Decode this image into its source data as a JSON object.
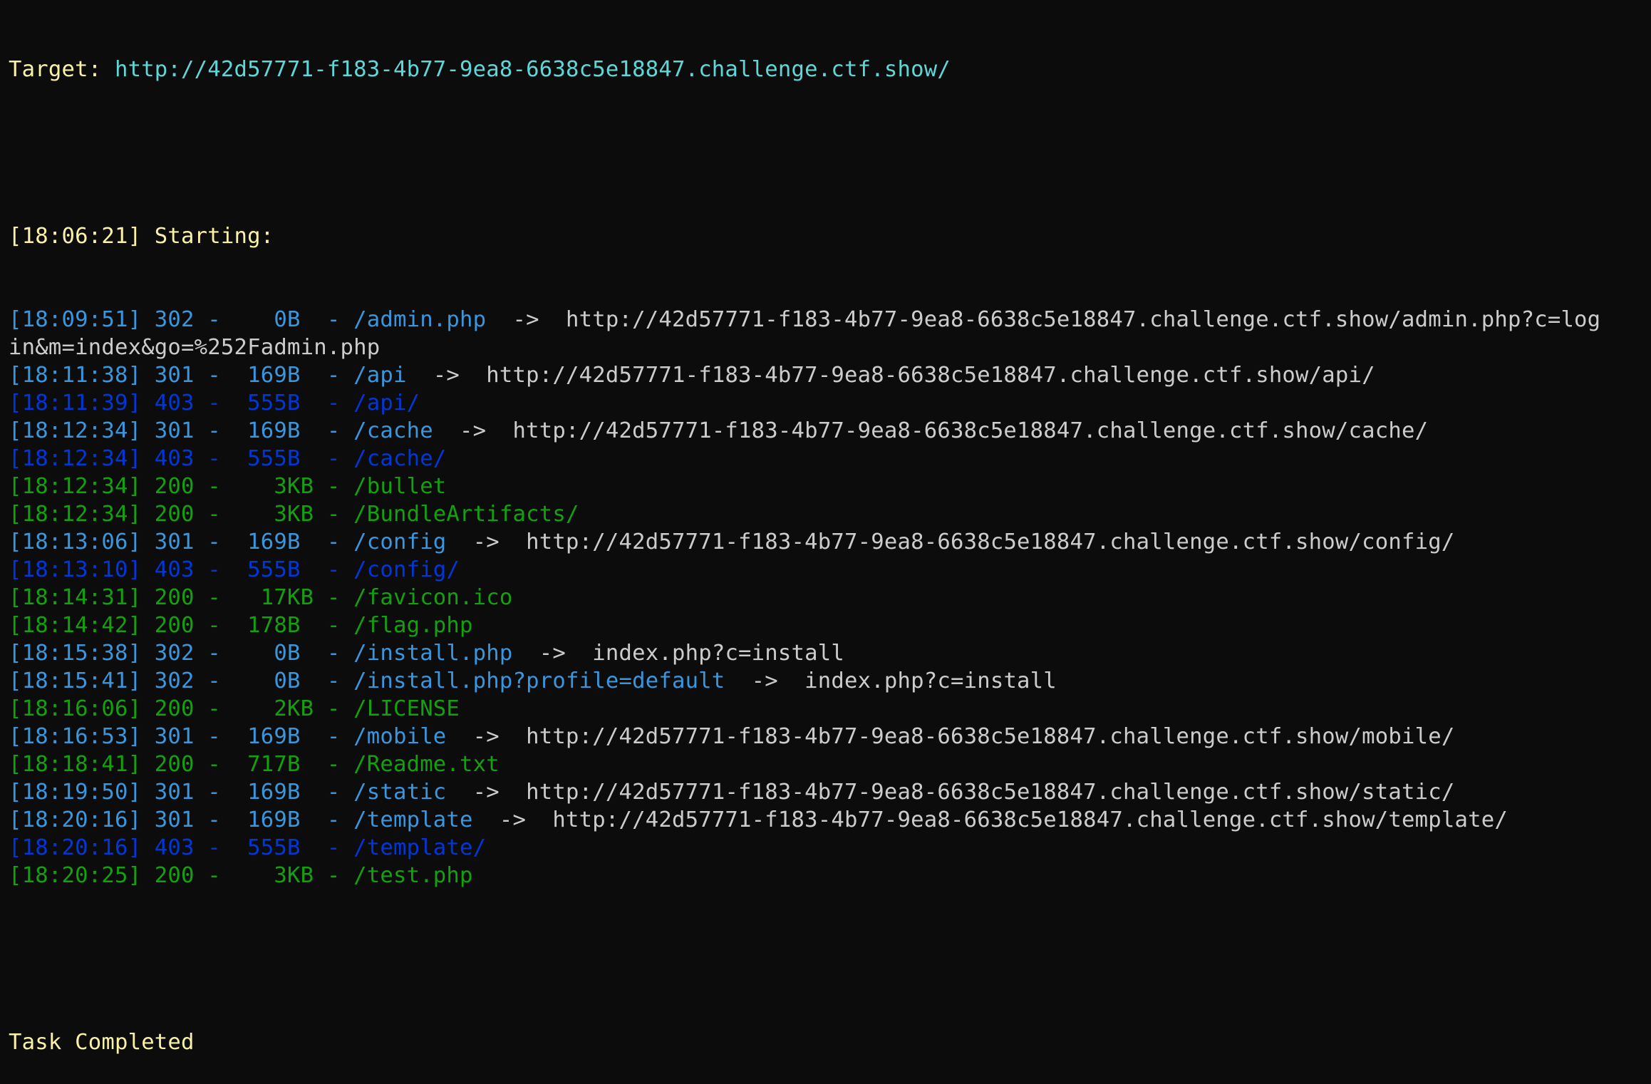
{
  "header": {
    "target_label": "Target: ",
    "target_url": "http://42d57771-f183-4b77-9ea8-6638c5e18847.challenge.ctf.show/",
    "start_line": "[18:06:21] Starting: "
  },
  "colors": {
    "302": "#3a96dd",
    "301": "#3a96dd",
    "403": "#0037da",
    "200": "#13a10e",
    "text": "#cccccc",
    "yellow": "#f9f1a5",
    "cyan": "#61d6d6",
    "background": "#0c0c0c"
  },
  "rows": [
    {
      "prefix": "[18:09:51] 302 -    0B  - /admin.php",
      "arrow": "  ->  ",
      "redirect": "http://42d57771-f183-4b77-9ea8-6638c5e18847.challenge.ctf.show/admin.php?c=log",
      "status": "302"
    },
    {
      "prefix": "",
      "arrow": "",
      "redirect": "in&m=index&go=%252Fadmin.php",
      "status": "cont"
    },
    {
      "prefix": "[18:11:38] 301 -  169B  - /api",
      "arrow": "  ->  ",
      "redirect": "http://42d57771-f183-4b77-9ea8-6638c5e18847.challenge.ctf.show/api/",
      "status": "301"
    },
    {
      "prefix": "[18:11:39] 403 -  555B  - /api/",
      "arrow": "",
      "redirect": "",
      "status": "403"
    },
    {
      "prefix": "[18:12:34] 301 -  169B  - /cache",
      "arrow": "  ->  ",
      "redirect": "http://42d57771-f183-4b77-9ea8-6638c5e18847.challenge.ctf.show/cache/",
      "status": "301"
    },
    {
      "prefix": "[18:12:34] 403 -  555B  - /cache/",
      "arrow": "",
      "redirect": "",
      "status": "403"
    },
    {
      "prefix": "[18:12:34] 200 -    3KB - /bullet",
      "arrow": "",
      "redirect": "",
      "status": "200"
    },
    {
      "prefix": "[18:12:34] 200 -    3KB - /BundleArtifacts/",
      "arrow": "",
      "redirect": "",
      "status": "200"
    },
    {
      "prefix": "[18:13:06] 301 -  169B  - /config",
      "arrow": "  ->  ",
      "redirect": "http://42d57771-f183-4b77-9ea8-6638c5e18847.challenge.ctf.show/config/",
      "status": "301"
    },
    {
      "prefix": "[18:13:10] 403 -  555B  - /config/",
      "arrow": "",
      "redirect": "",
      "status": "403"
    },
    {
      "prefix": "[18:14:31] 200 -   17KB - /favicon.ico",
      "arrow": "",
      "redirect": "",
      "status": "200"
    },
    {
      "prefix": "[18:14:42] 200 -  178B  - /flag.php",
      "arrow": "",
      "redirect": "",
      "status": "200"
    },
    {
      "prefix": "[18:15:38] 302 -    0B  - /install.php",
      "arrow": "  ->  ",
      "redirect": "index.php?c=install",
      "status": "302"
    },
    {
      "prefix": "[18:15:41] 302 -    0B  - /install.php?profile=default",
      "arrow": "  ->  ",
      "redirect": "index.php?c=install",
      "status": "302"
    },
    {
      "prefix": "[18:16:06] 200 -    2KB - /LICENSE",
      "arrow": "",
      "redirect": "",
      "status": "200"
    },
    {
      "prefix": "[18:16:53] 301 -  169B  - /mobile",
      "arrow": "  ->  ",
      "redirect": "http://42d57771-f183-4b77-9ea8-6638c5e18847.challenge.ctf.show/mobile/",
      "status": "301"
    },
    {
      "prefix": "[18:18:41] 200 -  717B  - /Readme.txt",
      "arrow": "",
      "redirect": "",
      "status": "200"
    },
    {
      "prefix": "[18:19:50] 301 -  169B  - /static",
      "arrow": "  ->  ",
      "redirect": "http://42d57771-f183-4b77-9ea8-6638c5e18847.challenge.ctf.show/static/",
      "status": "301"
    },
    {
      "prefix": "[18:20:16] 301 -  169B  - /template",
      "arrow": "  ->  ",
      "redirect": "http://42d57771-f183-4b77-9ea8-6638c5e18847.challenge.ctf.show/template/",
      "status": "301"
    },
    {
      "prefix": "[18:20:16] 403 -  555B  - /template/",
      "arrow": "",
      "redirect": "",
      "status": "403"
    },
    {
      "prefix": "[18:20:25] 200 -    3KB - /test.php",
      "arrow": "",
      "redirect": "",
      "status": "200"
    }
  ],
  "footer": {
    "completed": "Task Completed"
  }
}
